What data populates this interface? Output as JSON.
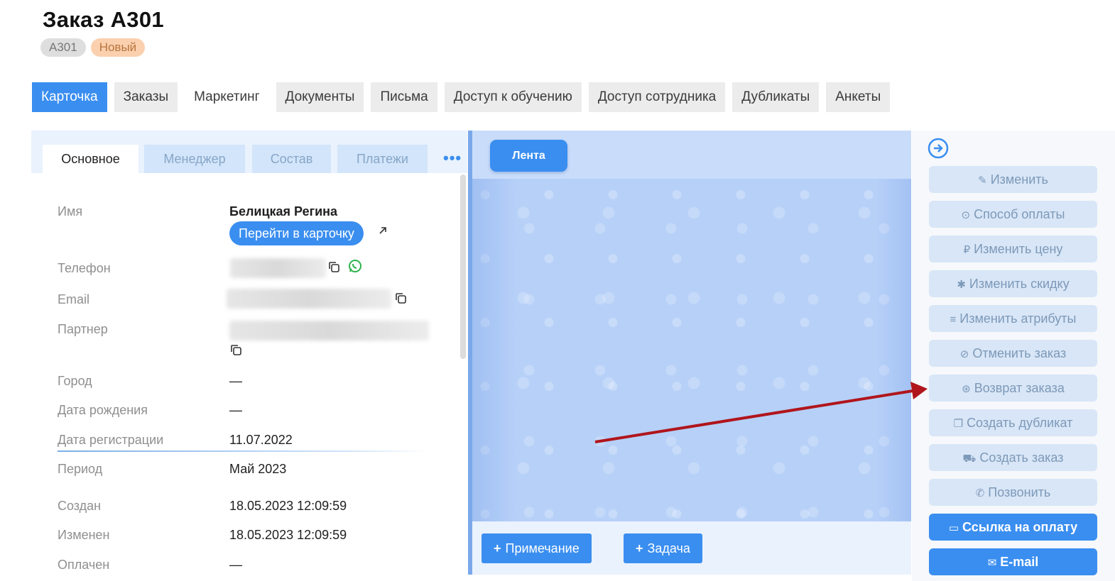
{
  "header": {
    "title": "Заказ А301",
    "code_badge": "А301",
    "status_badge": "Новый"
  },
  "main_tabs": [
    {
      "label": "Карточка",
      "active": true
    },
    {
      "label": "Заказы"
    },
    {
      "label": "Маркетинг"
    },
    {
      "label": "Документы"
    },
    {
      "label": "Письма"
    },
    {
      "label": "Доступ к обучению"
    },
    {
      "label": "Доступ сотрудника"
    },
    {
      "label": "Дубликаты"
    },
    {
      "label": "Анкеты"
    }
  ],
  "sub_tabs": [
    {
      "label": "Основное",
      "active": true
    },
    {
      "label": "Менеджер"
    },
    {
      "label": "Состав"
    },
    {
      "label": "Платежи"
    }
  ],
  "more_label": "•••",
  "fields": {
    "name": {
      "label": "Имя",
      "value": "Белицкая Регина"
    },
    "go_card": "Перейти в карточку",
    "phone": {
      "label": "Телефон"
    },
    "email": {
      "label": "Email"
    },
    "partner": {
      "label": "Партнер"
    },
    "city": {
      "label": "Город",
      "value": "—"
    },
    "birth": {
      "label": "Дата рождения",
      "value": "—"
    },
    "registration": {
      "label": "Дата регистрации",
      "value": "11.07.2022"
    },
    "period": {
      "label": "Период",
      "value": "Май 2023"
    },
    "created": {
      "label": "Создан",
      "value": "18.05.2023 12:09:59"
    },
    "changed": {
      "label": "Изменен",
      "value": "18.05.2023 12:09:59"
    },
    "paid": {
      "label": "Оплачен",
      "value": "—"
    }
  },
  "feed": {
    "lenta_label": "Лента",
    "note_label": "Примечание",
    "task_label": "Задача"
  },
  "actions": [
    {
      "label": "Изменить",
      "icon": "user-edit-icon",
      "glyph": "✎"
    },
    {
      "label": "Способ оплаты",
      "icon": "payment-method-icon",
      "glyph": "⊙"
    },
    {
      "label": "Изменить цену",
      "icon": "ruble-icon",
      "glyph": "₽"
    },
    {
      "label": "Изменить скидку",
      "icon": "discount-icon",
      "glyph": "✱"
    },
    {
      "label": "Изменить атрибуты",
      "icon": "attributes-icon",
      "glyph": "≡"
    },
    {
      "label": "Отменить заказ",
      "icon": "cancel-icon",
      "glyph": "⊘"
    },
    {
      "label": "Возврат заказа",
      "icon": "refund-icon",
      "glyph": "⊛"
    },
    {
      "label": "Создать дубликат",
      "icon": "duplicate-icon",
      "glyph": "❐"
    },
    {
      "label": "Создать заказ",
      "icon": "cart-icon",
      "glyph": "⛟"
    },
    {
      "label": "Позвонить",
      "icon": "phone-icon",
      "glyph": "✆"
    },
    {
      "label": "Ссылка на оплату",
      "icon": "card-icon",
      "glyph": "▭",
      "primary": true
    },
    {
      "label": "E-mail",
      "icon": "mail-icon",
      "glyph": "✉",
      "primary": true
    }
  ],
  "colors": {
    "accent": "#3a8ef0",
    "arrow": "#b0151c",
    "status_badge_bg": "#fbd0ae"
  }
}
